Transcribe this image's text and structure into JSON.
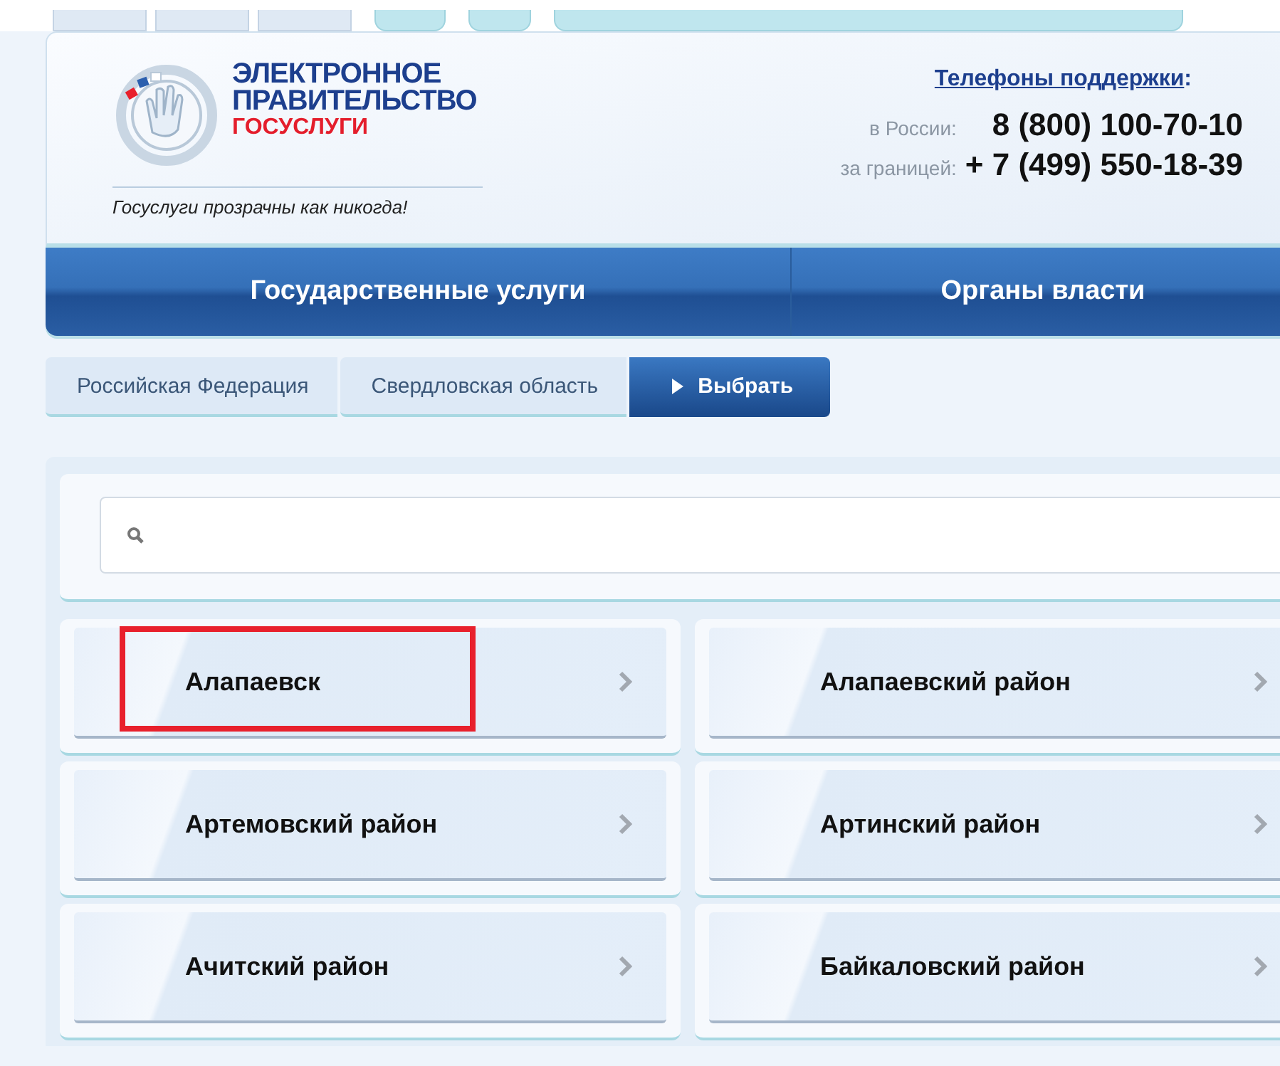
{
  "header": {
    "title_lines": [
      "ЭЛЕКТРОННОЕ",
      "ПРАВИТЕЛЬСТВО"
    ],
    "subtitle": "ГОСУСЛУГИ",
    "slogan": "Госуслуги прозрачны как никогда!",
    "support": {
      "link": "Телефоны поддержки",
      "suffix": ":",
      "phones": [
        {
          "label": "в России:",
          "number": "8 (800) 100-70-10"
        },
        {
          "label": "за границей:",
          "number": "+ 7 (499) 550-18-39"
        }
      ]
    }
  },
  "nav": [
    "Государственные услуги",
    "Органы власти"
  ],
  "breadcrumbs": [
    {
      "label": "Российская Федерация",
      "selected": false
    },
    {
      "label": "Свердловская область",
      "selected": false
    },
    {
      "label": "Выбрать",
      "selected": true
    }
  ],
  "regions": [
    {
      "label": "Алапаевск",
      "highlighted": true
    },
    {
      "label": "Алапаевский район",
      "highlighted": false
    },
    {
      "label": "Артемовский район",
      "highlighted": false
    },
    {
      "label": "Артинский район",
      "highlighted": false
    },
    {
      "label": "Ачитский район",
      "highlighted": false
    },
    {
      "label": "Байкаловский район",
      "highlighted": false
    }
  ]
}
